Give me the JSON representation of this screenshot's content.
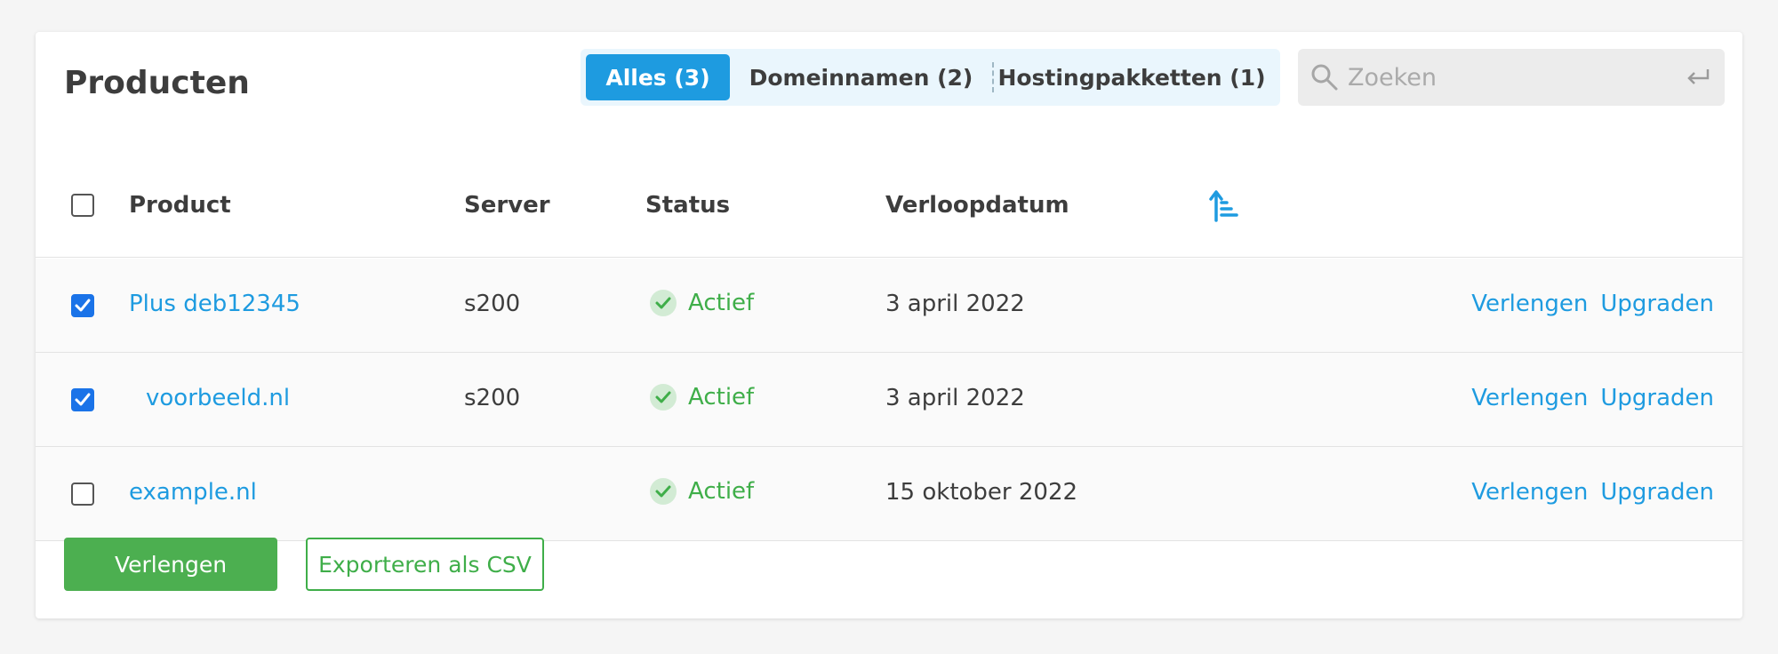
{
  "page": {
    "title": "Producten"
  },
  "filters": {
    "tabs": [
      {
        "label": "Alles (3)",
        "active": true
      },
      {
        "label": "Domeinnamen (2)",
        "active": false
      },
      {
        "label": "Hostingpakketten (1)",
        "active": false
      }
    ]
  },
  "search": {
    "placeholder": "Zoeken",
    "value": ""
  },
  "table": {
    "columns": [
      "Product",
      "Server",
      "Status",
      "Verloopdatum"
    ],
    "rows": [
      {
        "checked": true,
        "product": "Plus deb12345",
        "server": "s200",
        "status": "Actief",
        "expiry": "3 april 2022",
        "actions": [
          "Verlengen",
          "Upgraden"
        ]
      },
      {
        "checked": true,
        "product": "voorbeeld.nl",
        "server": "s200",
        "status": "Actief",
        "expiry": "3 april 2022",
        "actions": [
          "Verlengen",
          "Upgraden"
        ]
      },
      {
        "checked": false,
        "product": "example.nl",
        "server": "",
        "status": "Actief",
        "expiry": "15 oktober 2022",
        "actions": [
          "Verlengen",
          "Upgraden"
        ]
      }
    ]
  },
  "footer": {
    "primary_label": "Verlengen",
    "secondary_label": "Exporteren als CSV"
  },
  "colors": {
    "accent": "#1e9be0",
    "success": "#3fae49",
    "primary_button": "#4caf50",
    "checkbox": "#1a73e8"
  },
  "icons": {
    "search": "search-icon",
    "enter": "enter-icon",
    "sort": "sort-ascending-icon",
    "status": "check-circle-icon"
  }
}
